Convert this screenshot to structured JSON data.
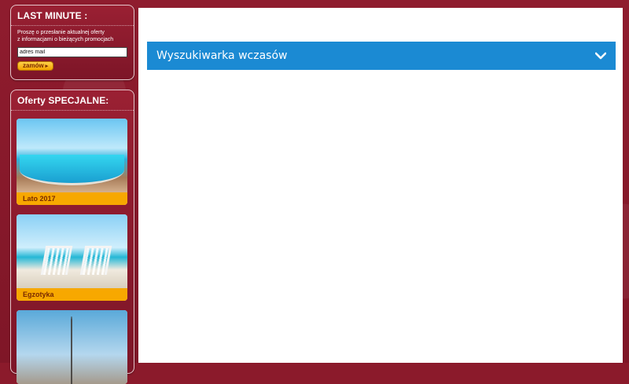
{
  "last_minute": {
    "title": "LAST MINUTE :",
    "description": "Proszę o przesłanie aktualnej oferty\nz informacjami o bieżących promocjach",
    "email_value": "adres mail",
    "order_label": "zamów"
  },
  "specials": {
    "title": "Oferty SPECJALNE:",
    "offers": [
      {
        "label": "Lato 2017"
      },
      {
        "label": "Egzotyka"
      },
      {
        "label": ""
      }
    ]
  },
  "main": {
    "search_title": "Wyszukiwarka wczasów",
    "chevron_icon": "chevron-down-icon"
  },
  "colors": {
    "background": "#8b1a2b",
    "accent_blue": "#1b8ad3",
    "offer_label": "#f7a800"
  }
}
